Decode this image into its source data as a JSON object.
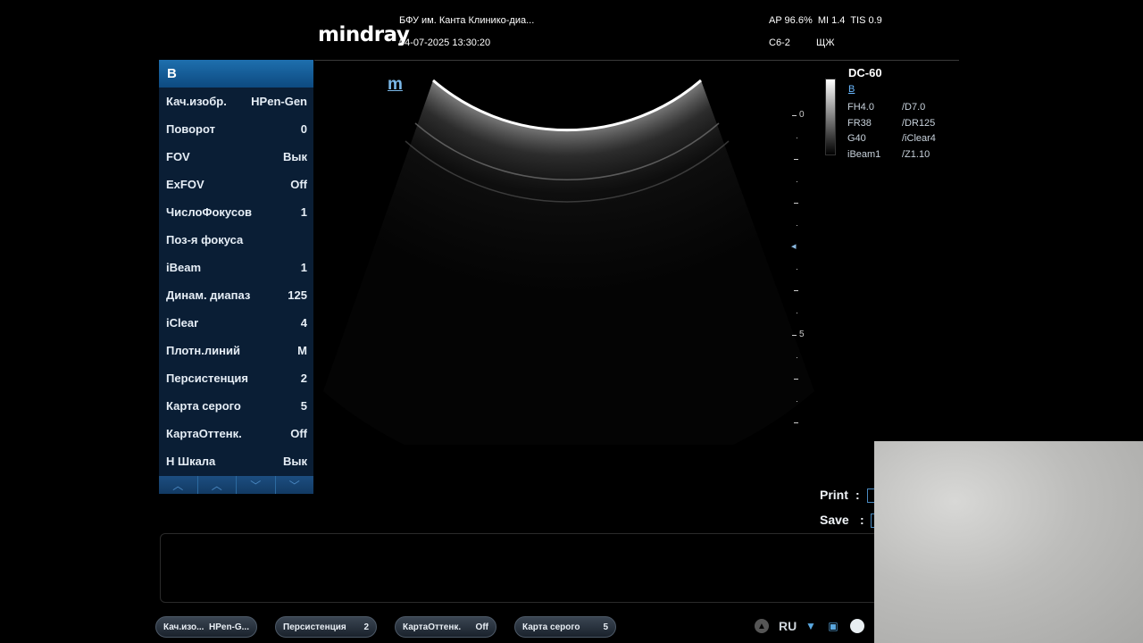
{
  "header": {
    "brand": "mindray",
    "institution": "БФУ им. Канта Клинико-диа...",
    "datetime": "04-07-2025 13:30:20",
    "safety": "AP 96.6%  MI 1.4  TIS 0.9",
    "probe": "C6-2",
    "exam": "ЩЖ"
  },
  "menu": {
    "title": "B",
    "items": [
      {
        "label": "Кач.изобр.",
        "value": "HPen-Gen"
      },
      {
        "label": "Поворот",
        "value": "0"
      },
      {
        "label": "FOV",
        "value": "Вык"
      },
      {
        "label": "ExFOV",
        "value": "Off"
      },
      {
        "label": "ЧислоФокусов",
        "value": "1"
      },
      {
        "label": "Поз-я фокуса",
        "value": ""
      },
      {
        "label": "iBeam",
        "value": "1"
      },
      {
        "label": "Динам. диапаз",
        "value": "125"
      },
      {
        "label": "iClear",
        "value": "4"
      },
      {
        "label": "Плотн.линий",
        "value": "M"
      },
      {
        "label": "Персистенция",
        "value": "2"
      },
      {
        "label": "Карта серого",
        "value": "5"
      },
      {
        "label": "КартаОттенк.",
        "value": "Off"
      },
      {
        "label": "Н Шкала",
        "value": "Вык"
      }
    ]
  },
  "image": {
    "marker": "m",
    "depth_labels": [
      "0",
      "5"
    ]
  },
  "params": {
    "model": "DC-60",
    "mode": "B",
    "left": [
      "FH4.0",
      "FR38",
      "G40",
      "iBeam1"
    ],
    "right": [
      "/D7.0",
      "/DR125",
      "/iClear4",
      "/Z1.10"
    ]
  },
  "save_print": {
    "print_label": "Print",
    "save_label": "Save",
    "sep": ":"
  },
  "bottom": {
    "buttons": [
      {
        "label": "Кач.изо...",
        "value": "HPen-G..."
      },
      {
        "label": "Персистенция",
        "value": "2"
      },
      {
        "label": "КартаОттенк.",
        "value": "Off"
      },
      {
        "label": "Карта серого",
        "value": "5"
      }
    ],
    "language": "RU"
  },
  "colors": {
    "menu_bg": "#0a1e35",
    "menu_title": "#1e6fae",
    "accent_text": "#6ab8ff"
  }
}
